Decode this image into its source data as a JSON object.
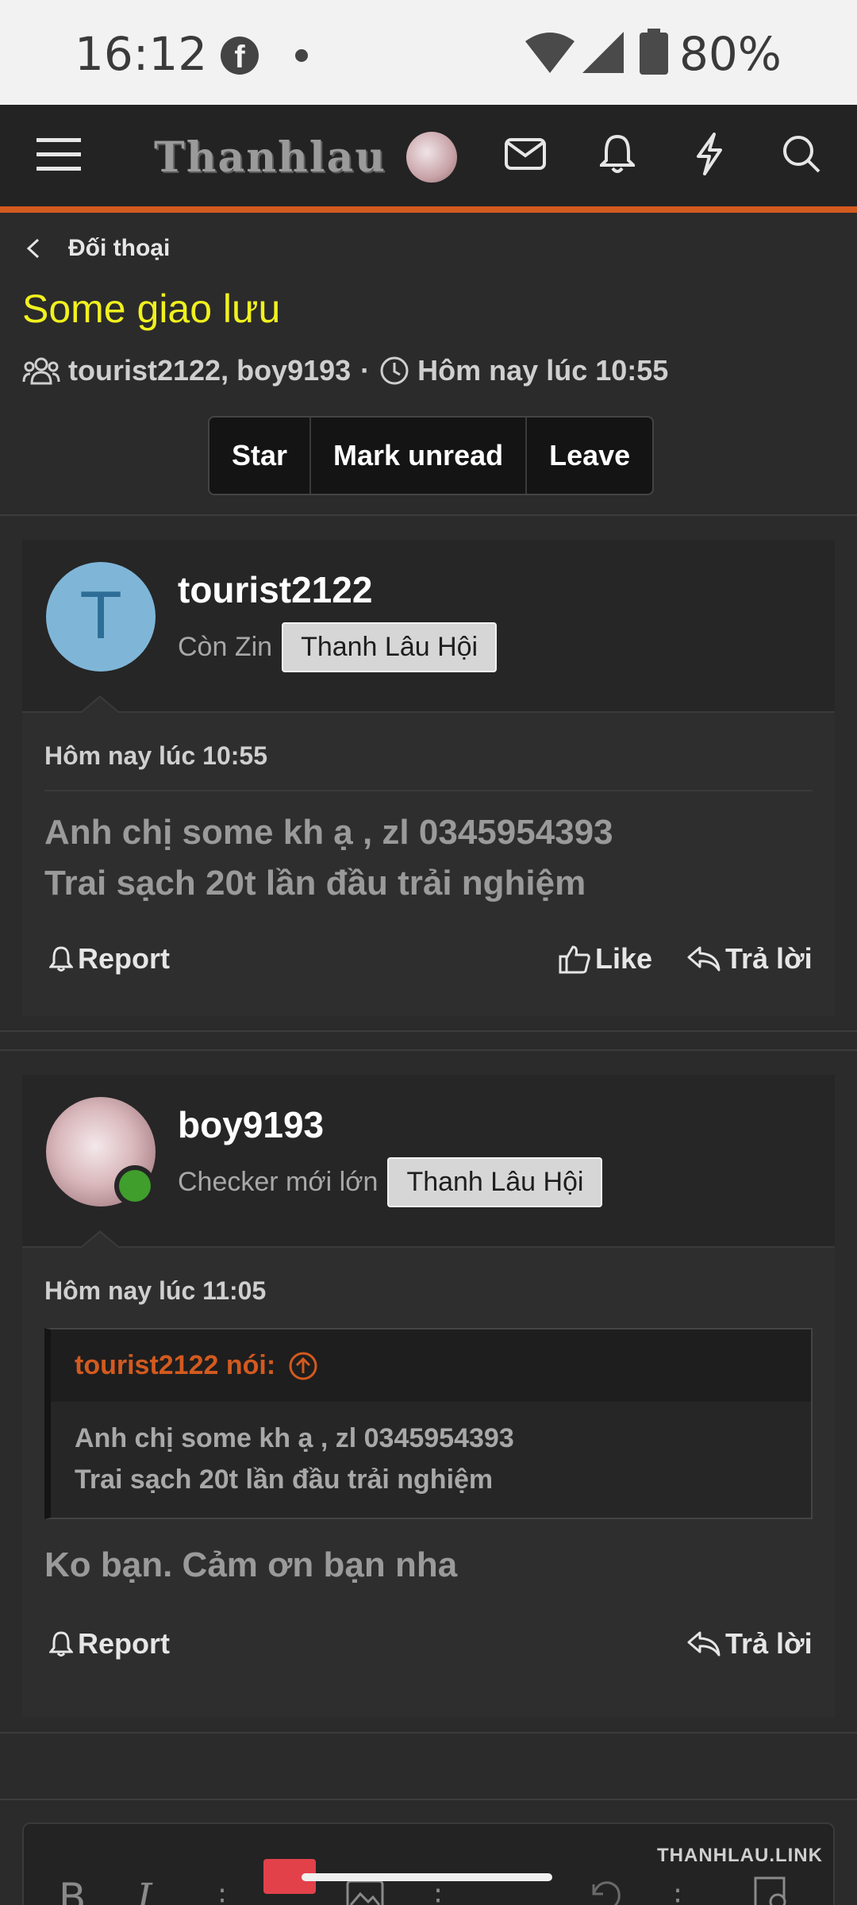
{
  "status_bar": {
    "time": "16:12",
    "battery": "80%"
  },
  "nav": {
    "logo": "Thanhlau"
  },
  "breadcrumb": {
    "label": "Đối thoại"
  },
  "conversation": {
    "title": "Some giao lưu",
    "participants": "tourist2122, boy9193",
    "started": "Hôm nay lúc 10:55"
  },
  "actions": {
    "star": "Star",
    "mark_unread": "Mark unread",
    "leave": "Leave"
  },
  "messages": [
    {
      "avatar_letter": "T",
      "username": "tourist2122",
      "user_title": "Còn Zin",
      "banner": "Thanh Lâu Hội",
      "date": "Hôm nay lúc 10:55",
      "text_line1": "Anh chị some kh ạ , zl 0345954393",
      "text_line2": "Trai sạch 20t lần đầu trải nghiệm",
      "report": "Report",
      "like": "Like",
      "reply": "Trả lời"
    },
    {
      "username": "boy9193",
      "user_title": "Checker mới lớn",
      "banner": "Thanh Lâu Hội",
      "date": "Hôm nay lúc 11:05",
      "quote_author": "tourist2122 nói:",
      "quote_line1": "Anh chị some kh ạ , zl 0345954393",
      "quote_line2": "Trai sạch 20t lần đầu trải nghiệm",
      "text": "Ko bạn. Cảm ơn bạn nha",
      "report": "Report",
      "reply": "Trả lời"
    }
  ],
  "editor": {
    "bold": "B",
    "italic": "I"
  },
  "watermark": "THANHLAU.LINK"
}
